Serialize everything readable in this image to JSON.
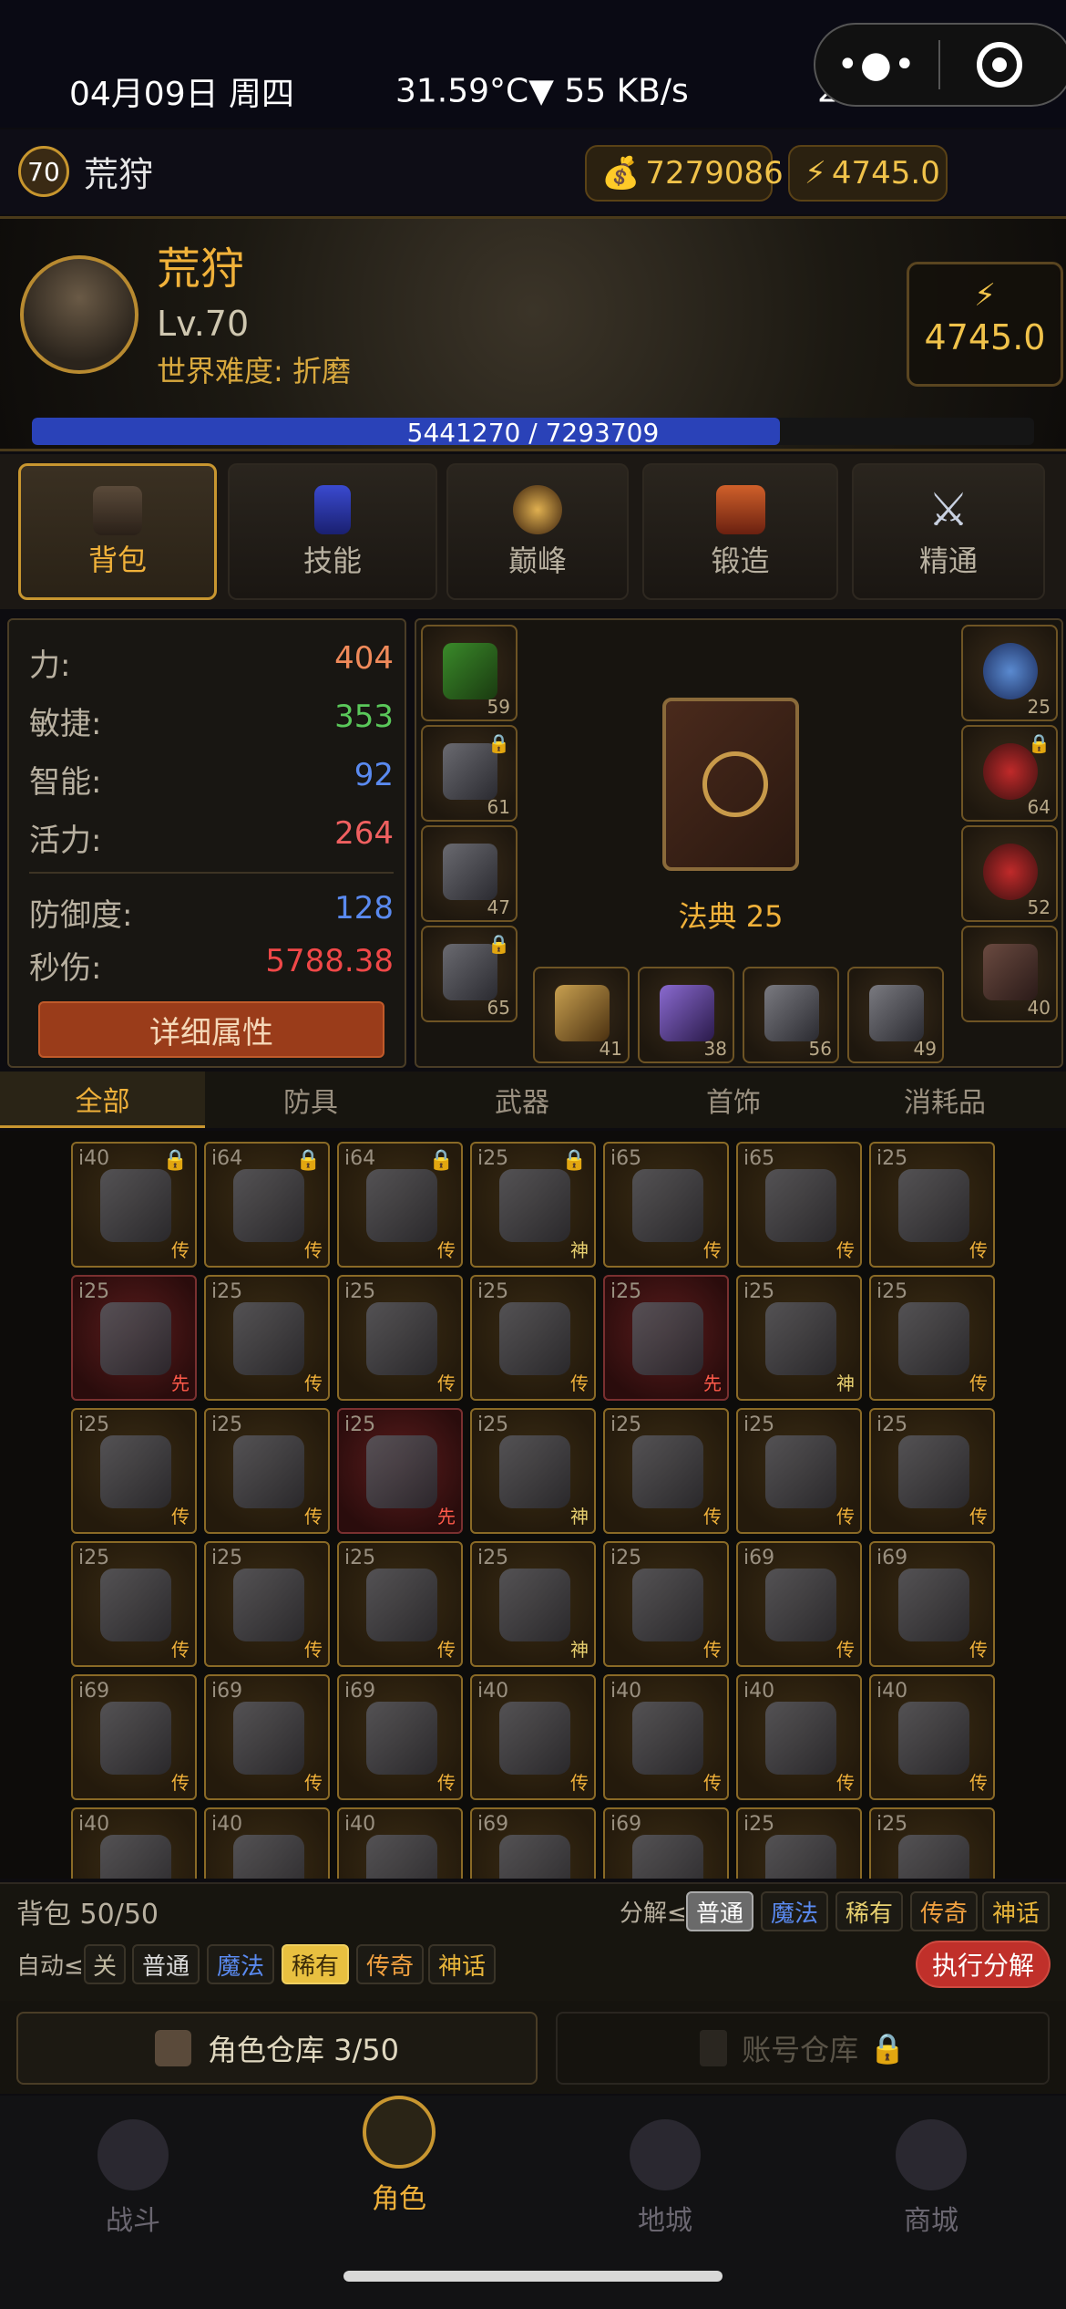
{
  "status_bar": {
    "date": "04月09日 周四",
    "temp_speed": "31.59°C▼ 55 KB/s",
    "time": "23:20:52"
  },
  "header": {
    "level": "70",
    "name": "荒狩",
    "gold": "7279086",
    "energy": "4745.0"
  },
  "hero": {
    "name": "荒狩",
    "level": "Lv.70",
    "difficulty": "世界难度: 折磨",
    "energy_value": "4745.0",
    "xp_text": "5441270 / 7293709",
    "xp_fraction": 0.746
  },
  "tabs": [
    {
      "label": "背包",
      "icon": "chest-icon",
      "active": true
    },
    {
      "label": "技能",
      "icon": "rune-icon",
      "active": false
    },
    {
      "label": "巅峰",
      "icon": "paragon-star-icon",
      "active": false
    },
    {
      "label": "锻造",
      "icon": "forge-chest-icon",
      "active": false
    },
    {
      "label": "精通",
      "icon": "crossed-swords-icon",
      "active": false
    }
  ],
  "stats": {
    "strength": {
      "label": "力:",
      "value": "404"
    },
    "dexterity": {
      "label": "敏捷:",
      "value": "353"
    },
    "intelligence": {
      "label": "智能:",
      "value": "92"
    },
    "vitality": {
      "label": "活力:",
      "value": "264"
    },
    "defense": {
      "label": "防御度:",
      "value": "128"
    },
    "dps": {
      "label": "秒伤:",
      "value": "5788.38"
    },
    "detail_button": "详细属性"
  },
  "equipment": {
    "left": [
      {
        "level": "59",
        "locked": false
      },
      {
        "level": "61",
        "locked": true
      },
      {
        "level": "47",
        "locked": false
      },
      {
        "level": "65",
        "locked": true
      }
    ],
    "right": [
      {
        "level": "25",
        "locked": false
      },
      {
        "level": "64",
        "locked": true
      },
      {
        "level": "52",
        "locked": false
      },
      {
        "level": "40",
        "locked": false
      }
    ],
    "bottom": [
      {
        "level": "41"
      },
      {
        "level": "38"
      },
      {
        "level": "56"
      },
      {
        "level": "49"
      }
    ],
    "book_label": "法典 25"
  },
  "category_tabs": [
    "全部",
    "防具",
    "武器",
    "首饰",
    "消耗品"
  ],
  "inventory": [
    [
      {
        "lvl": "i40",
        "r": "传",
        "lock": true
      },
      {
        "lvl": "i64",
        "r": "传",
        "lock": true
      },
      {
        "lvl": "i64",
        "r": "传",
        "lock": true
      },
      {
        "lvl": "i25",
        "r": "神",
        "lock": true
      },
      {
        "lvl": "i65",
        "r": "传"
      },
      {
        "lvl": "i65",
        "r": "传"
      },
      {
        "lvl": "i25",
        "r": "传"
      }
    ],
    [
      {
        "lvl": "i25",
        "r": "先",
        "red": true
      },
      {
        "lvl": "i25",
        "r": "传"
      },
      {
        "lvl": "i25",
        "r": "传"
      },
      {
        "lvl": "i25",
        "r": "传"
      },
      {
        "lvl": "i25",
        "r": "先",
        "red": true
      },
      {
        "lvl": "i25",
        "r": "神"
      },
      {
        "lvl": "i25",
        "r": "传"
      }
    ],
    [
      {
        "lvl": "i25",
        "r": "传"
      },
      {
        "lvl": "i25",
        "r": "传"
      },
      {
        "lvl": "i25",
        "r": "先",
        "red": true
      },
      {
        "lvl": "i25",
        "r": "神"
      },
      {
        "lvl": "i25",
        "r": "传"
      },
      {
        "lvl": "i25",
        "r": "传"
      },
      {
        "lvl": "i25",
        "r": "传"
      }
    ],
    [
      {
        "lvl": "i25",
        "r": "传"
      },
      {
        "lvl": "i25",
        "r": "传"
      },
      {
        "lvl": "i25",
        "r": "传"
      },
      {
        "lvl": "i25",
        "r": "神"
      },
      {
        "lvl": "i25",
        "r": "传"
      },
      {
        "lvl": "i69",
        "r": "传"
      },
      {
        "lvl": "i69",
        "r": "传"
      }
    ],
    [
      {
        "lvl": "i69",
        "r": "传"
      },
      {
        "lvl": "i69",
        "r": "传"
      },
      {
        "lvl": "i69",
        "r": "传"
      },
      {
        "lvl": "i40",
        "r": "传"
      },
      {
        "lvl": "i40",
        "r": "传"
      },
      {
        "lvl": "i40",
        "r": "传"
      },
      {
        "lvl": "i40",
        "r": "传"
      }
    ],
    [
      {
        "lvl": "i40",
        "r": ""
      },
      {
        "lvl": "i40",
        "r": ""
      },
      {
        "lvl": "i40",
        "r": ""
      },
      {
        "lvl": "i69",
        "r": ""
      },
      {
        "lvl": "i69",
        "r": ""
      },
      {
        "lvl": "i25",
        "r": ""
      },
      {
        "lvl": "i25",
        "r": ""
      }
    ]
  ],
  "bag": {
    "count": "背包 50/50",
    "salvage_label": "分解≤",
    "salvage_options": [
      "普通",
      "魔法",
      "稀有",
      "传奇",
      "神话"
    ],
    "auto_label": "自动≤",
    "auto_options": [
      "关",
      "普通",
      "魔法",
      "稀有",
      "传奇",
      "神话"
    ],
    "execute_button": "执行分解"
  },
  "storage": {
    "char_storage": "角色仓库 3/50",
    "account_storage": "账号仓库"
  },
  "bottom_nav": [
    {
      "label": "战斗",
      "active": false
    },
    {
      "label": "角色",
      "active": true
    },
    {
      "label": "地城",
      "active": false
    },
    {
      "label": "商城",
      "active": false
    }
  ],
  "colors": {
    "gold": "#e8b53a",
    "strength": "#f08a5a",
    "dexterity": "#5ac85a",
    "intelligence": "#5a8af0",
    "vitality": "#f06060",
    "defense": "#5a8af0",
    "dps": "#f04848"
  }
}
